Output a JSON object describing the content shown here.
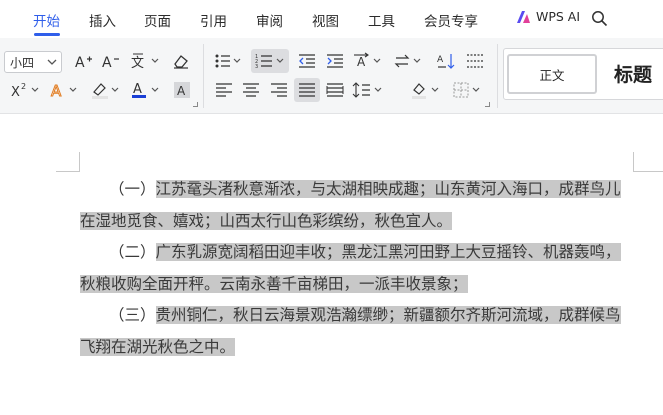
{
  "menu": {
    "tabs": [
      "开始",
      "插入",
      "页面",
      "引用",
      "审阅",
      "视图",
      "工具",
      "会员专享"
    ],
    "active_tab": "开始",
    "wps_ai_label": "WPS AI",
    "accent_color": "#2f5eea"
  },
  "ribbon": {
    "font_size": "小四",
    "styles": {
      "normal": "正文",
      "heading": "标题"
    },
    "icons": [
      "increase-font-icon",
      "decrease-font-icon",
      "phonetic-guide-icon",
      "clear-format-icon",
      "superscript-icon",
      "text-effect-icon",
      "highlight-icon",
      "font-color-icon",
      "character-shading-icon",
      "bullet-list-icon",
      "numbered-list-icon",
      "decrease-indent-icon",
      "increase-indent-icon",
      "text-direction-icon",
      "line-sort-icon",
      "sort-icon",
      "show-marks-icon",
      "align-left-icon",
      "align-center-icon",
      "align-right-icon",
      "justify-icon",
      "distributed-icon",
      "line-spacing-icon",
      "paragraph-shading-icon",
      "borders-icon"
    ],
    "font_color_swatch": "#1a3fd6",
    "highlight_swatch": "#e4e4e4"
  },
  "document": {
    "selection_color": "#c8c8c8",
    "lines": [
      {
        "plain": "（一）",
        "selected": "江苏鼋头渚秋意渐浓，与太湖相映成趣；山东黄河入海口，成群鸟儿"
      },
      {
        "plain": "",
        "selected": "在湿地觅食、嬉戏；山西太行山色彩缤纷，秋色宜人。"
      },
      {
        "plain": "（二）",
        "selected": "广东乳源宽阔稻田迎丰收；黑龙江黑河田野上大豆摇铃、机器轰鸣，"
      },
      {
        "plain": "",
        "selected": "秋粮收购全面开秤。云南永善千亩梯田，一派丰收景象；"
      },
      {
        "plain": "（三）",
        "selected": "贵州铜仁，秋日云海景观浩瀚缥缈；新疆额尔齐斯河流域，成群候鸟"
      },
      {
        "plain": "",
        "selected": "飞翔在湖光秋色之中。"
      }
    ]
  }
}
